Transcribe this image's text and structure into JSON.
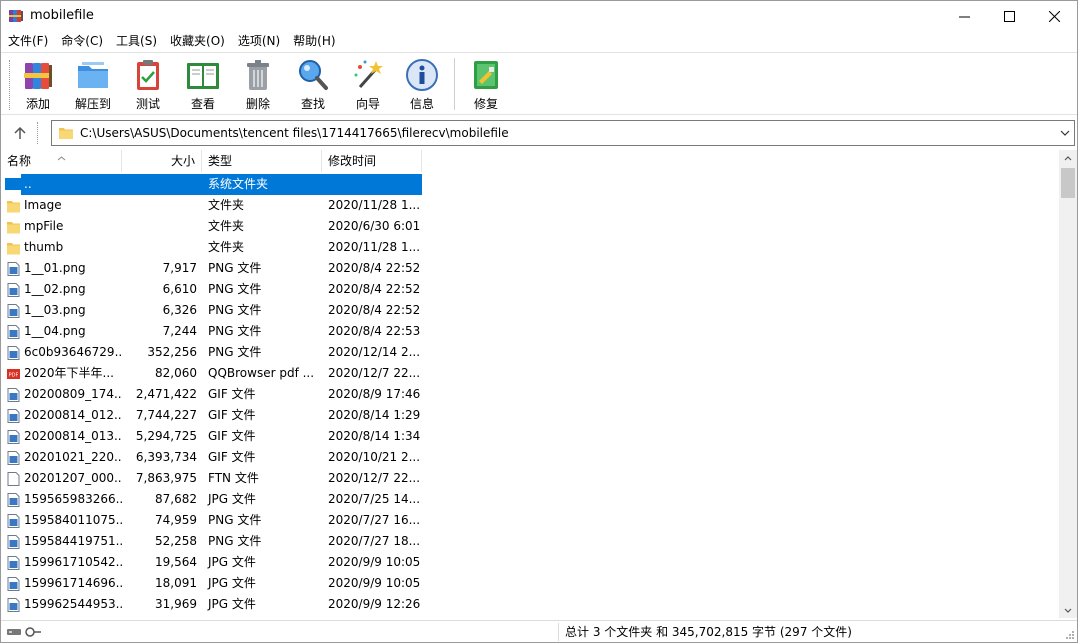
{
  "window": {
    "title": "mobilefile",
    "minimize": "—",
    "maximize": "☐",
    "close": "✕"
  },
  "menu": [
    "文件(F)",
    "命令(C)",
    "工具(S)",
    "收藏夹(O)",
    "选项(N)",
    "帮助(H)"
  ],
  "toolbar": {
    "add": "添加",
    "extract": "解压到",
    "test": "测试",
    "view": "查看",
    "delete": "删除",
    "find": "查找",
    "wizard": "向导",
    "info": "信息",
    "repair": "修复"
  },
  "address": {
    "path": "C:\\Users\\ASUS\\Documents\\tencent files\\1714417665\\filerecv\\mobilefile"
  },
  "columns": {
    "name": "名称",
    "size": "大小",
    "type": "类型",
    "date": "修改时间"
  },
  "rows": [
    {
      "icon": "folder-up-icon",
      "name": "..",
      "size": "",
      "type": "系统文件夹",
      "date": "",
      "selected": true
    },
    {
      "icon": "folder-icon",
      "name": "Image",
      "size": "",
      "type": "文件夹",
      "date": "2020/11/28 1..."
    },
    {
      "icon": "folder-icon",
      "name": "mpFile",
      "size": "",
      "type": "文件夹",
      "date": "2020/6/30 6:01"
    },
    {
      "icon": "folder-icon",
      "name": "thumb",
      "size": "",
      "type": "文件夹",
      "date": "2020/11/28 1..."
    },
    {
      "icon": "image-file-icon",
      "name": "1__01.png",
      "size": "7,917",
      "type": "PNG 文件",
      "date": "2020/8/4 22:52"
    },
    {
      "icon": "image-file-icon",
      "name": "1__02.png",
      "size": "6,610",
      "type": "PNG 文件",
      "date": "2020/8/4 22:52"
    },
    {
      "icon": "image-file-icon",
      "name": "1__03.png",
      "size": "6,326",
      "type": "PNG 文件",
      "date": "2020/8/4 22:52"
    },
    {
      "icon": "image-file-icon",
      "name": "1__04.png",
      "size": "7,244",
      "type": "PNG 文件",
      "date": "2020/8/4 22:53"
    },
    {
      "icon": "image-file-icon",
      "name": "6c0b93646729...",
      "size": "352,256",
      "type": "PNG 文件",
      "date": "2020/12/14 2..."
    },
    {
      "icon": "pdf-file-icon",
      "name": "2020年下半年...",
      "size": "82,060",
      "type": "QQBrowser pdf ...",
      "date": "2020/12/7 22..."
    },
    {
      "icon": "image-file-icon",
      "name": "20200809_174...",
      "size": "2,471,422",
      "type": "GIF 文件",
      "date": "2020/8/9 17:46"
    },
    {
      "icon": "image-file-icon",
      "name": "20200814_012...",
      "size": "7,744,227",
      "type": "GIF 文件",
      "date": "2020/8/14 1:29"
    },
    {
      "icon": "image-file-icon",
      "name": "20200814_013...",
      "size": "5,294,725",
      "type": "GIF 文件",
      "date": "2020/8/14 1:34"
    },
    {
      "icon": "image-file-icon",
      "name": "20201021_220...",
      "size": "6,393,734",
      "type": "GIF 文件",
      "date": "2020/10/21 2..."
    },
    {
      "icon": "blank-file-icon",
      "name": "20201207_000...",
      "size": "7,863,975",
      "type": "FTN 文件",
      "date": "2020/12/7 22..."
    },
    {
      "icon": "image-file-icon",
      "name": "159565983266...",
      "size": "87,682",
      "type": "JPG 文件",
      "date": "2020/7/25 14..."
    },
    {
      "icon": "image-file-icon",
      "name": "159584011075...",
      "size": "74,959",
      "type": "PNG 文件",
      "date": "2020/7/27 16..."
    },
    {
      "icon": "image-file-icon",
      "name": "159584419751...",
      "size": "52,258",
      "type": "PNG 文件",
      "date": "2020/7/27 18..."
    },
    {
      "icon": "image-file-icon",
      "name": "159961710542...",
      "size": "19,564",
      "type": "JPG 文件",
      "date": "2020/9/9 10:05"
    },
    {
      "icon": "image-file-icon",
      "name": "159961714696...",
      "size": "18,091",
      "type": "JPG 文件",
      "date": "2020/9/9 10:05"
    },
    {
      "icon": "image-file-icon",
      "name": "159962544953...",
      "size": "31,969",
      "type": "JPG 文件",
      "date": "2020/9/9 12:26"
    }
  ],
  "status": {
    "summary": "总计 3 个文件夹 和 345,702,815 字节 (297 个文件)"
  },
  "colors": {
    "selection": "#0078d7",
    "folder": "#f8d775"
  }
}
